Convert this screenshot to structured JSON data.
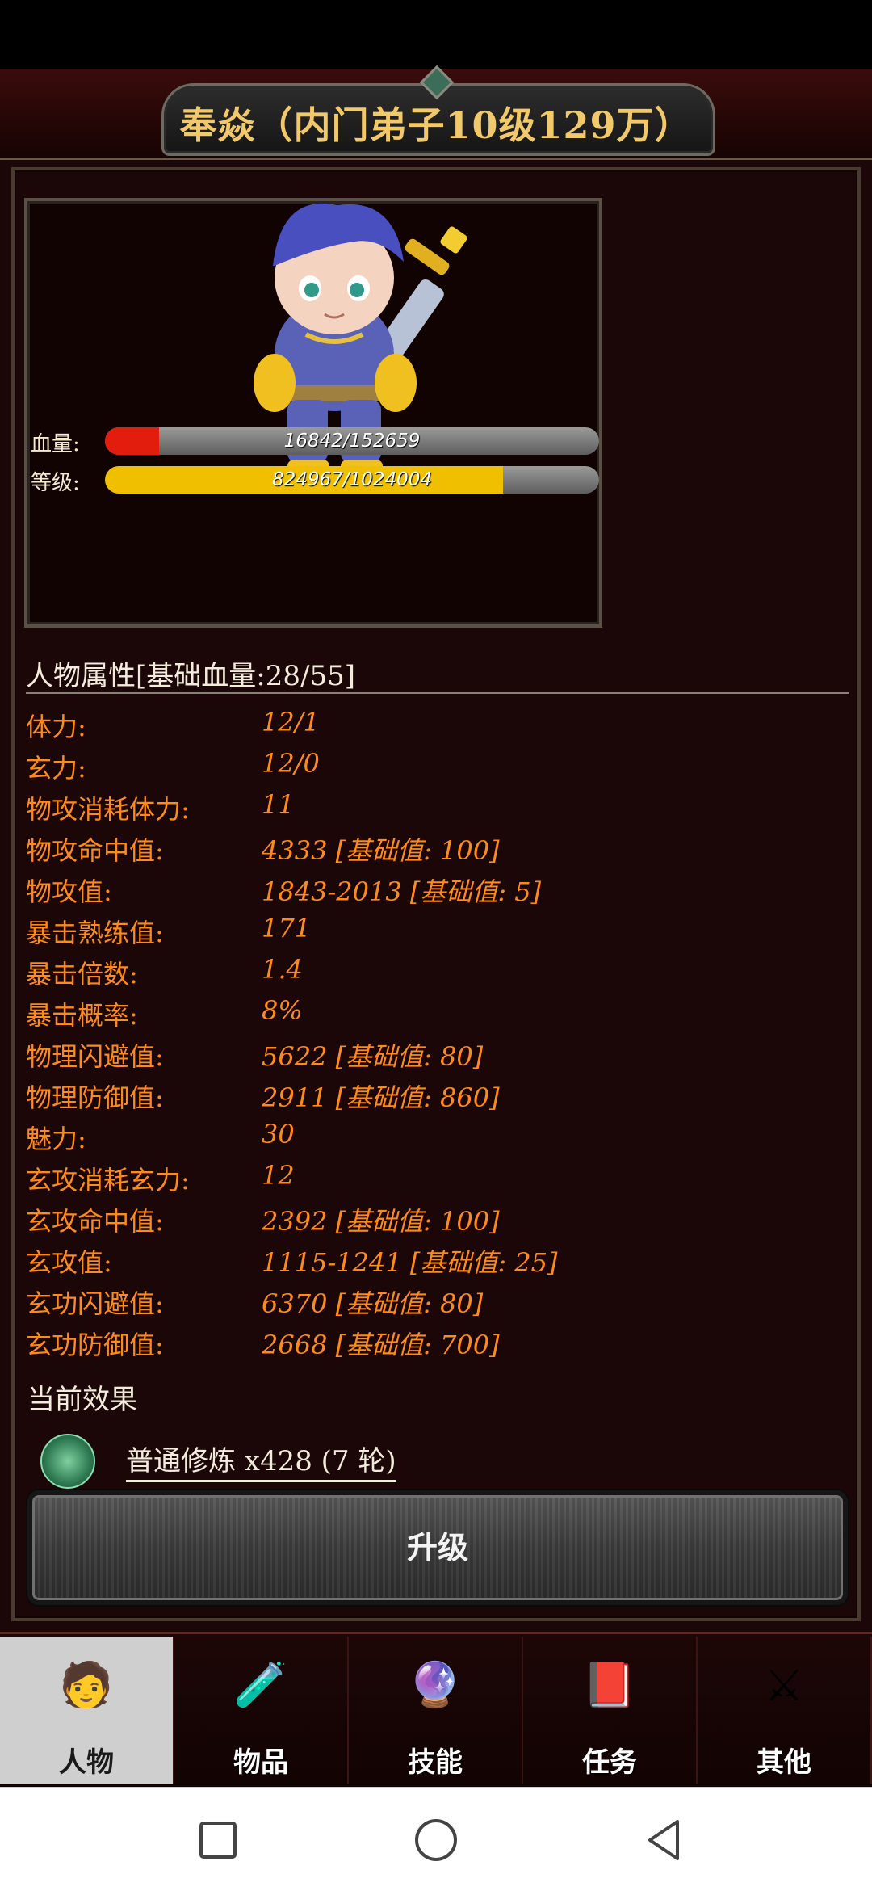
{
  "header": {
    "title": "奉焱（内门弟子10级129万）"
  },
  "portrait": {
    "hp_label": "血量:",
    "hp_value": "16842/152659",
    "hp_fraction": 0.11,
    "level_label": "等级:",
    "level_value": "824967/1024004",
    "level_fraction": 0.806,
    "hp_color": "#e31d0e",
    "level_color": "#f0c000"
  },
  "attributes": {
    "title": "人物属性[基础血量:28/55]",
    "rows": [
      {
        "label": "体力:",
        "value": "12/1"
      },
      {
        "label": "玄力:",
        "value": "12/0"
      },
      {
        "label": "物攻消耗体力:",
        "value": "11"
      },
      {
        "label": "物攻命中值:",
        "value": "4333 [基础值: 100]"
      },
      {
        "label": "物攻值:",
        "value": "1843-2013 [基础值: 5]"
      },
      {
        "label": "暴击熟练值:",
        "value": "171"
      },
      {
        "label": "暴击倍数:",
        "value": "1.4"
      },
      {
        "label": "暴击概率:",
        "value": "8%"
      },
      {
        "label": "物理闪避值:",
        "value": "5622 [基础值: 80]"
      },
      {
        "label": "物理防御值:",
        "value": "2911 [基础值: 860]"
      },
      {
        "label": "魅力:",
        "value": "30"
      },
      {
        "label": "玄攻消耗玄力:",
        "value": "12"
      },
      {
        "label": "玄攻命中值:",
        "value": "2392 [基础值: 100]"
      },
      {
        "label": "玄攻值:",
        "value": "1115-1241 [基础值: 25]"
      },
      {
        "label": "玄功闪避值:",
        "value": "6370 [基础值: 80]"
      },
      {
        "label": "玄功防御值:",
        "value": "2668 [基础值: 700]"
      }
    ]
  },
  "effects": {
    "title": "当前效果",
    "item_text": "普通修炼 x428 (7 轮)",
    "item_icon": "meditation-icon"
  },
  "upgrade_button": {
    "label": "升级"
  },
  "tabs": [
    {
      "label": "人物",
      "icon": "character-icon",
      "active": true
    },
    {
      "label": "物品",
      "icon": "potion-icon",
      "active": false
    },
    {
      "label": "技能",
      "icon": "skill-orb-icon",
      "active": false
    },
    {
      "label": "任务",
      "icon": "quest-book-icon",
      "active": false
    },
    {
      "label": "其他",
      "icon": "sword-shield-icon",
      "active": false
    }
  ]
}
